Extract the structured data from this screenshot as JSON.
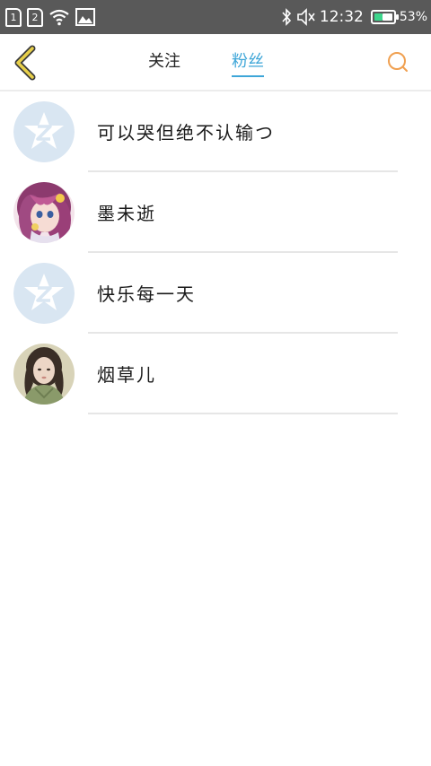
{
  "status_bar": {
    "sim1": "1",
    "sim2": "2",
    "time": "12:32",
    "battery_percent": "53%",
    "battery_color": "#3dd68c",
    "icons": [
      "sim1-icon",
      "sim2-icon",
      "wifi-icon",
      "image-icon",
      "bluetooth-icon",
      "mute-icon",
      "battery-icon"
    ]
  },
  "header": {
    "tabs": [
      {
        "label": "关注",
        "active": false
      },
      {
        "label": "粉丝",
        "active": true
      }
    ],
    "accent_color": "#3ea6d8",
    "back_icon_color": "#e8d04a",
    "search_icon_color": "#f0a050"
  },
  "fans": [
    {
      "name": "可以哭但绝不认输つ",
      "avatar": "default-qq-avatar"
    },
    {
      "name": "墨未逝",
      "avatar": "anime-girl-avatar"
    },
    {
      "name": "快乐每一天",
      "avatar": "default-qq-avatar"
    },
    {
      "name": "烟草儿",
      "avatar": "photo-girl-avatar"
    }
  ]
}
